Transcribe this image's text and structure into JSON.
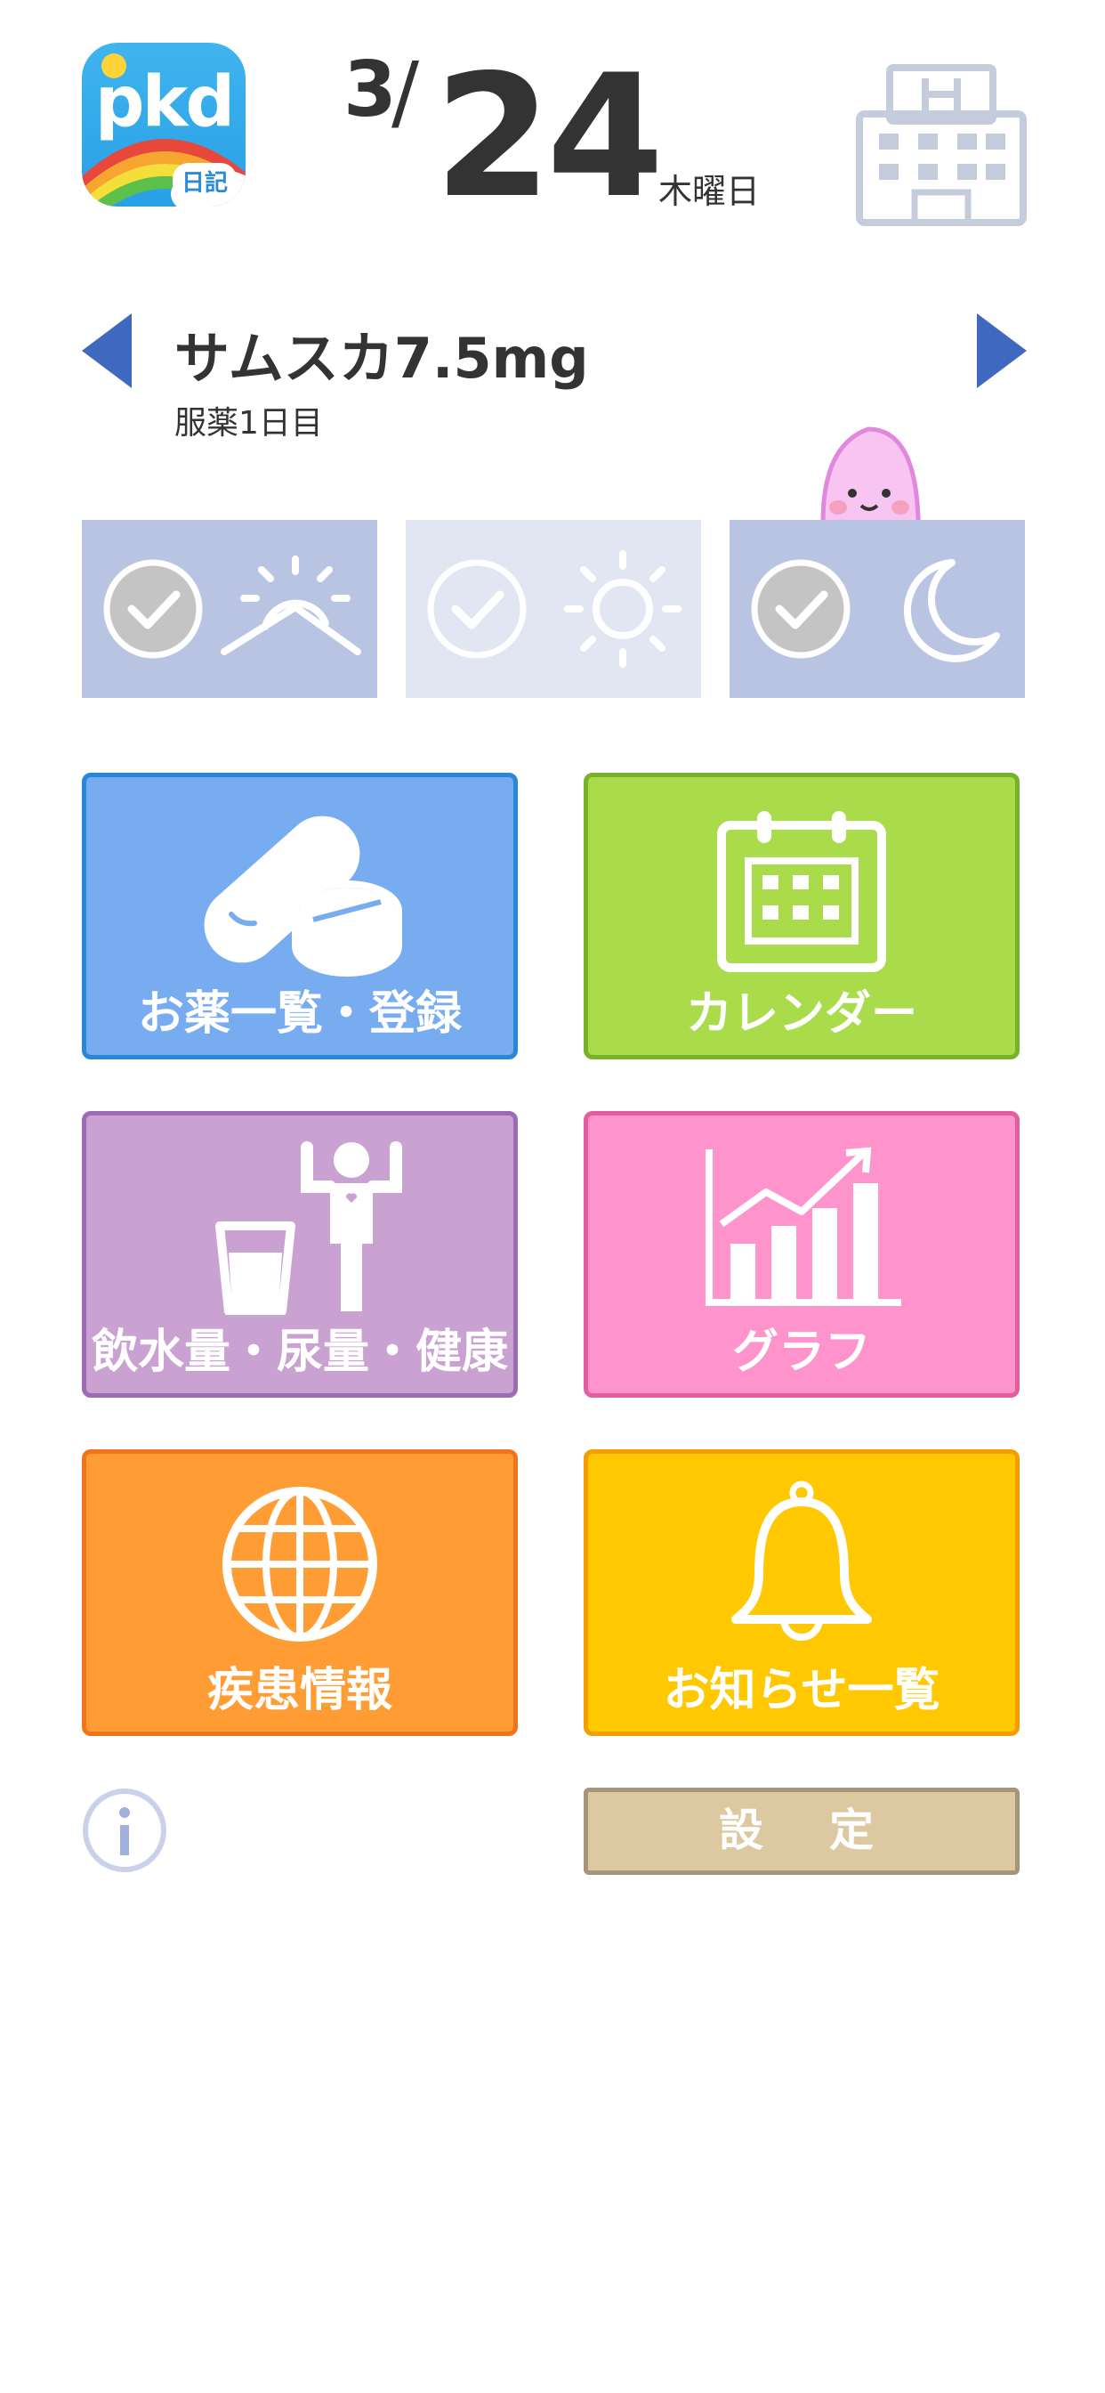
{
  "header": {
    "app_logo_text": "pkd",
    "app_logo_badge": "日記",
    "date_month": "3",
    "date_slash": "/",
    "date_day": "24",
    "weekday": "木曜日"
  },
  "medication": {
    "name": "サムスカ7.5mg",
    "day_label": "服薬1日目"
  },
  "time_slots": [
    {
      "slot": "morning",
      "icon": "sunrise-icon",
      "checked": true
    },
    {
      "slot": "noon",
      "icon": "sun-icon",
      "checked": false
    },
    {
      "slot": "night",
      "icon": "moon-icon",
      "checked": true
    }
  ],
  "tiles": {
    "medicine": {
      "label": "お薬一覧・登録",
      "icon": "pill-icon",
      "color": "#78acf1"
    },
    "calendar": {
      "label": "カレンダー",
      "icon": "calendar-icon",
      "color": "#aadb4b"
    },
    "water": {
      "label": "飲水量・尿量・健康",
      "icon": "water-person-icon",
      "color": "#c9a2d2"
    },
    "graph": {
      "label": "グラフ",
      "icon": "bar-chart-icon",
      "color": "#ff93cc"
    },
    "disease": {
      "label": "疾患情報",
      "icon": "globe-icon",
      "color": "#ff9d34"
    },
    "notice": {
      "label": "お知らせ一覧",
      "icon": "bell-icon",
      "color": "#ffc800"
    }
  },
  "footer": {
    "info_icon": "info-icon",
    "settings_label": "設　定"
  }
}
